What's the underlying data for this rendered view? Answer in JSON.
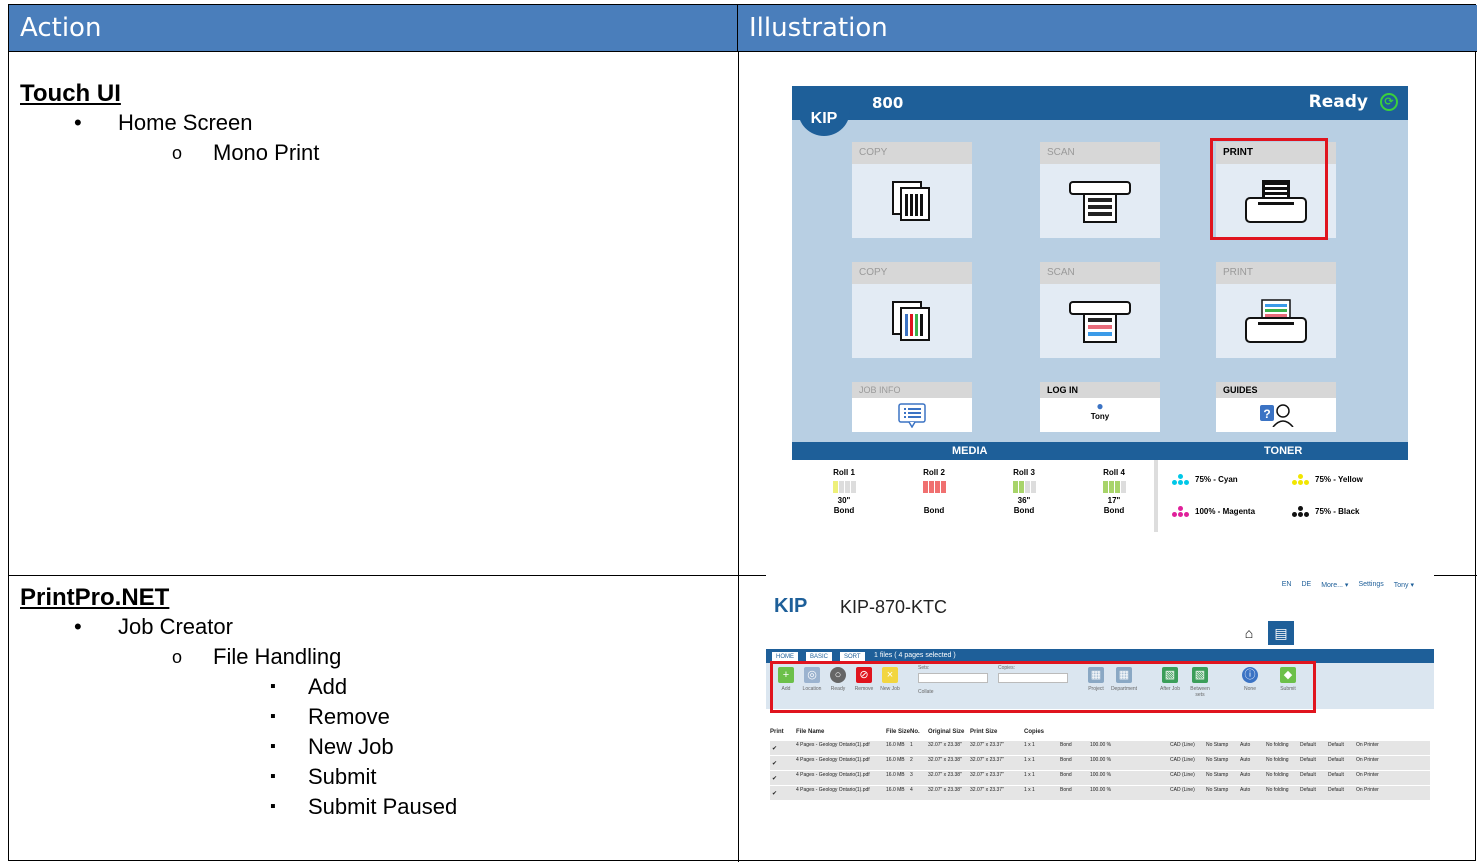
{
  "table": {
    "header_action": "Action",
    "header_illustration": "Illustration"
  },
  "rows": [
    {
      "title": "Touch UI",
      "items": [
        {
          "level": 1,
          "text": "Home Screen"
        },
        {
          "level": 2,
          "text": "Mono Print"
        }
      ]
    },
    {
      "title": "PrintPro.NET",
      "items": [
        {
          "level": 1,
          "text": "Job Creator"
        },
        {
          "level": 2,
          "text": "File Handling"
        },
        {
          "level": 3,
          "text": "Add"
        },
        {
          "level": 3,
          "text": "Remove"
        },
        {
          "level": 3,
          "text": "New Job"
        },
        {
          "level": 3,
          "text": "Submit"
        },
        {
          "level": 3,
          "text": "Submit Paused"
        }
      ]
    }
  ],
  "touch_ui": {
    "logo": "KIP",
    "model": "800",
    "status": "Ready",
    "tiles_row1": [
      "COPY",
      "SCAN",
      "PRINT"
    ],
    "tiles_row2": [
      "COPY",
      "SCAN",
      "PRINT"
    ],
    "tiles_row3": [
      "JOB INFO",
      "LOG IN",
      "GUIDES"
    ],
    "login_user": "Tony",
    "media_label": "MEDIA",
    "toner_label": "TONER",
    "rolls": [
      {
        "name": "Roll 1",
        "size": "30\"",
        "type": "Bond"
      },
      {
        "name": "Roll 2",
        "size": "",
        "type": "Bond"
      },
      {
        "name": "Roll 3",
        "size": "36\"",
        "type": "Bond"
      },
      {
        "name": "Roll 4",
        "size": "17\"",
        "type": "Bond"
      }
    ],
    "toners": [
      {
        "label": "75% - Cyan",
        "color": "#00c8e8"
      },
      {
        "label": "75% - Yellow",
        "color": "#f2e600"
      },
      {
        "label": "100% - Magenta",
        "color": "#e0209a"
      },
      {
        "label": "75% - Black",
        "color": "#111111"
      }
    ],
    "highlight_color": "#e0141e"
  },
  "printpro": {
    "logo": "KIP",
    "title": "KIP-870-KTC",
    "top_links": [
      "EN",
      "DE",
      "More... ▾",
      "Settings",
      "Tony ▾"
    ],
    "tabs": [
      "HOME",
      "BASIC",
      "SORT"
    ],
    "tab_status": "1 files ( 4 pages selected )",
    "toolbar": [
      "Add",
      "Location",
      "Ready",
      "Remove",
      "New Job",
      "Project",
      "Department",
      "After Job",
      "Between sets",
      "None",
      "Submit"
    ],
    "sets_label": "Sets:",
    "copies_label": "Copies:",
    "collate_label": "Collate",
    "columns": [
      "Print",
      "File Name",
      "File Size",
      "No.",
      "Original Size",
      "Print Size",
      "Copies"
    ],
    "file_rows": [
      {
        "name": "4 Pages - Geology Ontario(1).pdf",
        "size": "16.0 MB",
        "no": "1",
        "orig": "32.07\" x 23.38\"",
        "print": "32.07\" x 23.37\"",
        "copies": "1 x 1",
        "media": "Bond",
        "scale": "100.00 %",
        "mode": "CAD (Line)",
        "stamp": "No Stamp",
        "auto": "Auto",
        "fold": "No folding",
        "d1": "Default",
        "d2": "Default",
        "dest": "On Printer"
      },
      {
        "name": "4 Pages - Geology Ontario(1).pdf",
        "size": "16.0 MB",
        "no": "2",
        "orig": "32.07\" x 23.38\"",
        "print": "32.07\" x 23.37\"",
        "copies": "1 x 1",
        "media": "Bond",
        "scale": "100.00 %",
        "mode": "CAD (Line)",
        "stamp": "No Stamp",
        "auto": "Auto",
        "fold": "No folding",
        "d1": "Default",
        "d2": "Default",
        "dest": "On Printer"
      },
      {
        "name": "4 Pages - Geology Ontario(1).pdf",
        "size": "16.0 MB",
        "no": "3",
        "orig": "32.07\" x 23.38\"",
        "print": "32.07\" x 23.37\"",
        "copies": "1 x 1",
        "media": "Bond",
        "scale": "100.00 %",
        "mode": "CAD (Line)",
        "stamp": "No Stamp",
        "auto": "Auto",
        "fold": "No folding",
        "d1": "Default",
        "d2": "Default",
        "dest": "On Printer"
      },
      {
        "name": "4 Pages - Geology Ontario(1).pdf",
        "size": "16.0 MB",
        "no": "4",
        "orig": "32.07\" x 23.38\"",
        "print": "32.07\" x 23.37\"",
        "copies": "1 x 1",
        "media": "Bond",
        "scale": "100.00 %",
        "mode": "CAD (Line)",
        "stamp": "No Stamp",
        "auto": "Auto",
        "fold": "No folding",
        "d1": "Default",
        "d2": "Default",
        "dest": "On Printer"
      }
    ]
  }
}
